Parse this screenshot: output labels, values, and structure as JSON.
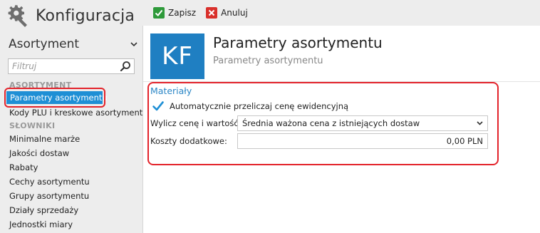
{
  "app": {
    "title": "Konfiguracja",
    "icon": "gear-wrench-icon"
  },
  "toolbar": {
    "save_label": "Zapisz",
    "cancel_label": "Anuluj"
  },
  "sidebar": {
    "module": "Asortyment",
    "filter_placeholder": "Filtruj",
    "sections": [
      {
        "label": "ASORTYMENT",
        "items": [
          {
            "label": "Parametry asortymentu",
            "active": true
          },
          {
            "label": "Kody PLU i kreskowe asortymentu",
            "active": false
          }
        ]
      },
      {
        "label": "SŁOWNIKI",
        "items": [
          {
            "label": "Minimalne marże"
          },
          {
            "label": "Jakości dostaw"
          },
          {
            "label": "Rabaty"
          },
          {
            "label": "Cechy asortymentu"
          },
          {
            "label": "Grupy asortymentu"
          },
          {
            "label": "Działy sprzedaży"
          },
          {
            "label": "Jednostki miary"
          }
        ]
      }
    ]
  },
  "main": {
    "tile_text": "KF",
    "title": "Parametry asortymentu",
    "subtitle": "Parametry asortymentu",
    "group": {
      "title": "Materiały",
      "checkbox_label": "Automatycznie przeliczaj cenę ewidencyjną",
      "checkbox_checked": true,
      "price_label": "Wylicz cenę i wartość:",
      "price_value": "Średnia ważona cena z istniejących dostaw",
      "cost_label": "Koszty dodatkowe:",
      "cost_value": "0,00 PLN"
    }
  },
  "colors": {
    "accent": "#1f7fc2",
    "active_nav": "#1e8fd5",
    "highlight": "#e3232b",
    "group_title": "#2a86c6"
  }
}
